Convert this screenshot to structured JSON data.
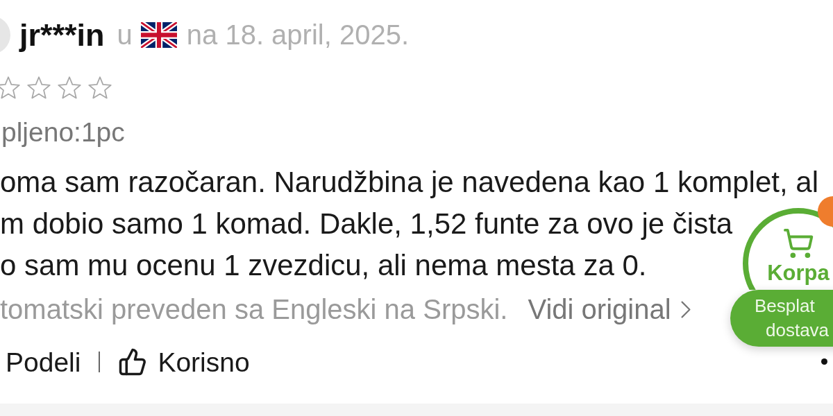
{
  "review": {
    "author": "jr***in",
    "country_prefix": "u",
    "date": "na 18. april, 2025.",
    "stars": 0,
    "purchased": "pljeno:1pc",
    "text_lines": [
      "oma sam razočaran. Narudžbina je navedena kao 1 komplet, al",
      "m dobio samo 1 komad. Dakle, 1,52 funte za ovo je čista",
      "o sam mu ocenu 1 zvezdicu, ali nema mesta za 0."
    ],
    "translation_note": "tomatski preveden sa Engleski na Srpski.",
    "original_link": "Vidi original",
    "actions": [
      {
        "kind": "share",
        "label": "Podeli"
      },
      {
        "kind": "helpful",
        "label": "Korisno"
      }
    ]
  },
  "cart_button": {
    "label": "Korpa",
    "promo_lines": [
      "Besplat",
      "dostava"
    ]
  }
}
